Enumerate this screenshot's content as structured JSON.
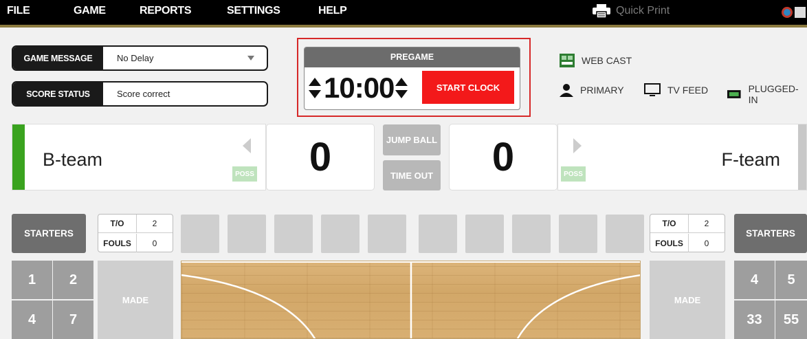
{
  "menu": {
    "file": "FILE",
    "game": "GAME",
    "reports": "REPORTS",
    "settings": "SETTINGS",
    "help": "HELP",
    "quick_print": "Quick Print"
  },
  "game_message": {
    "label": "GAME MESSAGE",
    "value": "No Delay"
  },
  "score_status": {
    "label": "SCORE STATUS",
    "value": "Score correct"
  },
  "clock": {
    "period": "PREGAME",
    "time": "10:00",
    "start_label": "START CLOCK"
  },
  "status": {
    "webcast": "WEB CAST",
    "primary": "PRIMARY",
    "tv_feed": "TV FEED",
    "plugged_in": "PLUGGED-IN"
  },
  "home": {
    "name": "B-team",
    "score": "0",
    "poss": "POSS",
    "color": "#3aa31f",
    "to_label": "T/O",
    "to_value": "2",
    "fouls_label": "FOULS",
    "fouls_value": "0",
    "starters": "STARTERS",
    "made": "MADE",
    "players": [
      "1",
      "2",
      "4",
      "7"
    ]
  },
  "away": {
    "name": "F-team",
    "score": "0",
    "poss": "POSS",
    "to_label": "T/O",
    "to_value": "2",
    "fouls_label": "FOULS",
    "fouls_value": "0",
    "starters": "STARTERS",
    "made": "MADE",
    "players": [
      "4",
      "5",
      "33",
      "55"
    ]
  },
  "center": {
    "jump_ball": "JUMP BALL",
    "time_out": "TIME OUT"
  },
  "colors": {
    "accent_red": "#f3191a",
    "menu_bg": "#000000",
    "gold_rule": "#8b7a3f"
  }
}
